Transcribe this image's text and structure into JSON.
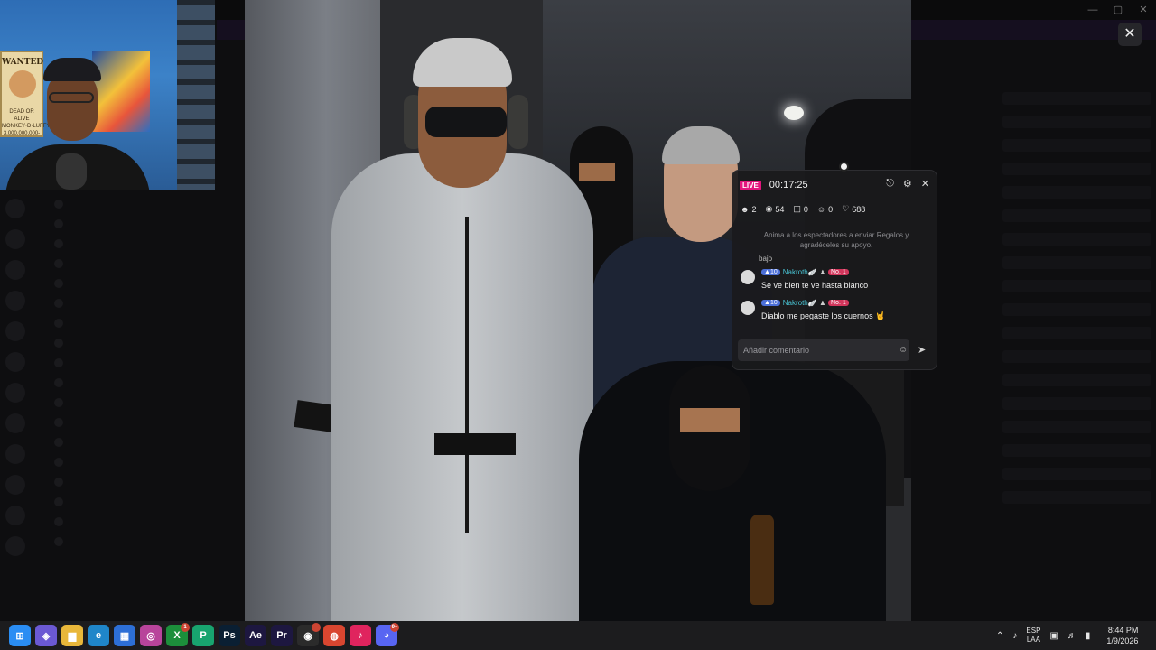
{
  "webcam": {
    "poster_text": "WANTED",
    "poster_line1": "DEAD OR ALIVE",
    "poster_line2": "MONKEY·D·LUFFY",
    "poster_bounty": "3,000,000,000-"
  },
  "background_window": {
    "close_label": "✕"
  },
  "live_panel": {
    "live_label": "LIVE",
    "timer": "00:17:25",
    "stats": {
      "members": "2",
      "viewers": "54",
      "gifts": "0",
      "follows": "0",
      "likes": "688"
    },
    "notice": "Anima a los espectadores a enviar Regalos y agradéceles su apoyo.",
    "scroll_fragment": "bajo",
    "comments": [
      {
        "level": "10",
        "username": "Nakroth🪽",
        "rank": "No. 1",
        "text": "Se ve bien te ve hasta blanco"
      },
      {
        "level": "10",
        "username": "Nakroth🪽",
        "rank": "No. 1",
        "text": "Diablo me pegaste los cuernos 🤘"
      }
    ],
    "input_placeholder": "Añadir comentario"
  },
  "taskbar": {
    "apps": [
      {
        "name": "Start",
        "glyph": "⊞",
        "color": "#2a8df3"
      },
      {
        "name": "Copilot",
        "glyph": "◈",
        "color": "#6b59d3"
      },
      {
        "name": "File Explorer",
        "glyph": "▆",
        "color": "#e8b73a"
      },
      {
        "name": "Edge",
        "glyph": "e",
        "color": "#1f86c9"
      },
      {
        "name": "Store",
        "glyph": "▦",
        "color": "#2d6fd6"
      },
      {
        "name": "Instagram",
        "glyph": "◎",
        "color": "#b8449b"
      },
      {
        "name": "Xbox",
        "glyph": "X",
        "color": "#1c8f3b",
        "badge": "1"
      },
      {
        "name": "App",
        "glyph": "P",
        "color": "#18a46f"
      },
      {
        "name": "Photoshop",
        "glyph": "Ps",
        "color": "#0a1f33"
      },
      {
        "name": "After Effects",
        "glyph": "Ae",
        "color": "#1d1740"
      },
      {
        "name": "Premiere",
        "glyph": "Pr",
        "color": "#1d1740"
      },
      {
        "name": "OBS",
        "glyph": "◉",
        "color": "#2b2b2b",
        "badge": ""
      },
      {
        "name": "Chrome",
        "glyph": "◍",
        "color": "#d94630"
      },
      {
        "name": "TikTok",
        "glyph": "♪",
        "color": "#e0245e"
      },
      {
        "name": "Discord",
        "glyph": "◕",
        "color": "#5865f2",
        "badge": "9+"
      }
    ],
    "lang_top": "ESP",
    "lang_bottom": "LAA",
    "time": "8:44 PM",
    "date": "1/9/2026"
  },
  "colors": {
    "live_pink": "#e3157d",
    "username_cyan": "#48c3d2",
    "taskbar": "#1c1c1e"
  }
}
